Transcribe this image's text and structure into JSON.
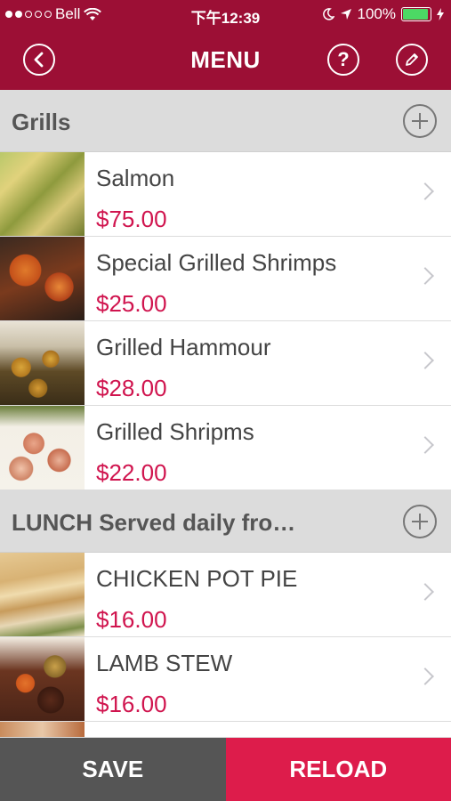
{
  "status_bar": {
    "carrier": "Bell",
    "time": "下午12:39",
    "battery": "100%",
    "signal_bars_filled": 2,
    "signal_bars_total": 5
  },
  "nav": {
    "title": "MENU",
    "back_icon": "chevron-left-icon",
    "help_icon": "question-icon",
    "edit_icon": "pencil-icon"
  },
  "sections": [
    {
      "title": "Grills",
      "items": [
        {
          "name": "Salmon",
          "price": "$75.00"
        },
        {
          "name": "Special Grilled Shrimps",
          "price": "$25.00"
        },
        {
          "name": "Grilled Hammour",
          "price": "$28.00"
        },
        {
          "name": "Grilled Shripms",
          "price": "$22.00"
        }
      ]
    },
    {
      "title": "LUNCH Served daily fro…",
      "items": [
        {
          "name": "CHICKEN POT PIE",
          "price": "$16.00"
        },
        {
          "name": "LAMB STEW",
          "price": "$16.00"
        }
      ]
    }
  ],
  "footer": {
    "save_label": "SAVE",
    "reload_label": "RELOAD"
  },
  "colors": {
    "brand": "#9c0f35",
    "price": "#d0144e",
    "save_bg": "#555555",
    "reload_bg": "#dd1c4b"
  }
}
